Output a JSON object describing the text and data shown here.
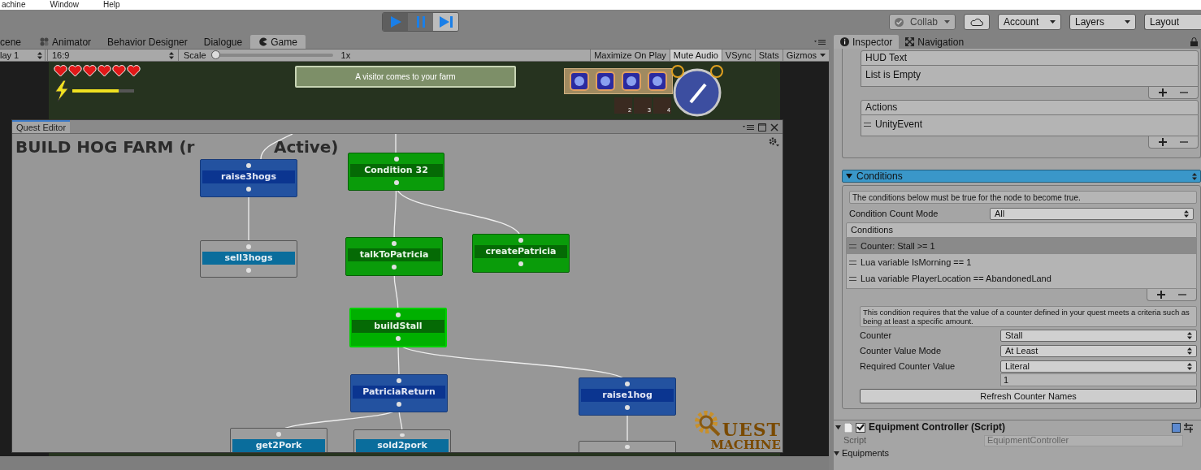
{
  "menu": [
    "achine",
    "Window",
    "Help"
  ],
  "play_controls": [
    {
      "kind": "play",
      "selected": true
    },
    {
      "kind": "pause",
      "selected": false
    },
    {
      "kind": "step",
      "selected": false
    }
  ],
  "toolbar_right": {
    "collab": "Collab",
    "account": "Account",
    "layers": "Layers",
    "layout": "Layout"
  },
  "left_tabs": [
    {
      "label": "cene",
      "kind": "scene",
      "selected": false
    },
    {
      "label": "Animator",
      "kind": "animator",
      "selected": false
    },
    {
      "label": "Behavior Designer",
      "kind": "behavior",
      "selected": false
    },
    {
      "label": "Dialogue",
      "kind": "dialogue",
      "selected": false
    },
    {
      "label": "Game",
      "kind": "game",
      "selected": true
    }
  ],
  "right_tabs": [
    {
      "label": "Inspector",
      "kind": "inspector",
      "selected": true
    },
    {
      "label": "Navigation",
      "kind": "navigation",
      "selected": false
    }
  ],
  "game_toolbar": {
    "display": "lay 1",
    "aspect": "16:9",
    "scale_label": "Scale",
    "scale": {
      "level": 0
    },
    "scale_value": "1x",
    "buttons": [
      {
        "label": "Maximize On Play",
        "selected": false
      },
      {
        "label": "Mute Audio",
        "selected": true
      },
      {
        "label": "VSync",
        "selected": false
      },
      {
        "label": "Stats",
        "selected": false
      },
      {
        "label": "Gizmos",
        "selected": false
      }
    ]
  },
  "game_hud": {
    "hearts": [
      {
        "full": true
      },
      {
        "full": true
      },
      {
        "full": true
      },
      {
        "full": true
      },
      {
        "full": true
      },
      {
        "full": true
      }
    ],
    "energy": {
      "level": 0.75
    },
    "banner": "A visitor comes to your farm",
    "tool_slots": [
      {
        "number": "2"
      },
      {
        "number": "3"
      },
      {
        "number": "4"
      }
    ]
  },
  "quest_editor": {
    "tab": "Quest Editor",
    "title_start": "BUILD HOG FARM (r",
    "title_end": "Active)",
    "nodes": [
      {
        "label": "raise3hogs",
        "kind": "active",
        "selected": false
      },
      {
        "label": "Condition 32",
        "kind": "success",
        "selected": false
      },
      {
        "label": "sell3hogs",
        "kind": "inactive",
        "selected": false
      },
      {
        "label": "talkToPatricia",
        "kind": "success",
        "selected": false
      },
      {
        "label": "createPatricia",
        "kind": "success",
        "selected": false
      },
      {
        "label": "buildStall",
        "kind": "success",
        "selected": true
      },
      {
        "label": "PatriciaReturn",
        "kind": "active",
        "selected": false
      },
      {
        "label": "raise1hog",
        "kind": "active",
        "selected": false
      },
      {
        "label": "get2Pork",
        "kind": "inactive",
        "selected": false
      },
      {
        "label": "sold2pork",
        "kind": "inactive",
        "selected": false
      },
      {
        "kind": "inactive",
        "selected": false
      }
    ],
    "logo": {
      "line1": "UEST",
      "line2": "MACHINE"
    }
  },
  "inspector": {
    "lists": [
      {
        "header": "HUD Text",
        "items": [
          {
            "text": "List is Empty",
            "kind": "empty"
          }
        ]
      },
      {
        "header": "Actions",
        "items": [
          {
            "text": "UnityEvent",
            "kind": "item"
          }
        ]
      }
    ],
    "conditions_section": {
      "title": "Conditions",
      "expanded": true,
      "help": "The conditions below must be true for the node to become true.",
      "count_mode": {
        "label": "Condition Count Mode",
        "value": "All"
      },
      "list_header": "Conditions",
      "items": [
        {
          "text": "Counter: Stall >= 1",
          "selected": true
        },
        {
          "text": "Lua variable IsMorning == 1",
          "selected": false
        },
        {
          "text": "Lua variable PlayerLocation == AbandonedLand",
          "selected": false
        }
      ],
      "detail_help": "This condition requires that the value of a counter defined in your quest meets a criteria such as being at least a specific amount.",
      "fields": [
        {
          "label": "Counter",
          "value": "Stall"
        },
        {
          "label": "Counter Value Mode",
          "value": "At Least"
        },
        {
          "label": "Required Counter Value",
          "value": "Literal"
        }
      ],
      "value_field": "1",
      "button": "Refresh Counter Names"
    },
    "component": {
      "title": "Equipment Controller (Script)",
      "enabled": true,
      "script_label": "Script",
      "script_value": "EquipmentController",
      "foldout": "Equipments"
    }
  }
}
